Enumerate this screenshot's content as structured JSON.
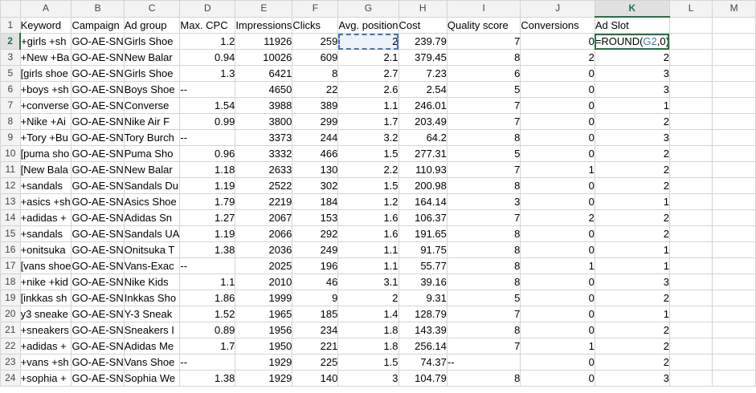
{
  "columns": [
    "A",
    "B",
    "C",
    "D",
    "E",
    "F",
    "G",
    "H",
    "I",
    "J",
    "K",
    "L",
    "M"
  ],
  "numeric_columns": [
    3,
    4,
    5,
    6,
    7,
    8,
    9,
    10
  ],
  "selected_column": "K",
  "selected_row": "2",
  "formula_cell": {
    "column_index": 10,
    "prefix": "=ROUND(",
    "reference": "G2",
    "suffix": ",0)"
  },
  "referenced_cell": {
    "row": "2",
    "column_index": 6
  },
  "rows": [
    {
      "n": "1",
      "cells": [
        "Keyword",
        "Campaign",
        "Ad group",
        "Max. CPC",
        "Impressions",
        "Clicks",
        "Avg. position",
        "Cost",
        "Quality score",
        "Conversions",
        "Ad Slot",
        "",
        ""
      ]
    },
    {
      "n": "2",
      "cells": [
        "+girls +sh",
        "GO-AE-SN",
        "Girls Shoe",
        "1.2",
        "11926",
        "259",
        "2",
        "239.79",
        "7",
        "0",
        "",
        "",
        ""
      ]
    },
    {
      "n": "3",
      "cells": [
        "+New +Ba",
        "GO-AE-SN",
        "New Balar",
        "0.94",
        "10026",
        "609",
        "2.1",
        "379.45",
        "8",
        "2",
        "2",
        "",
        ""
      ]
    },
    {
      "n": "5",
      "cells": [
        "[girls shoe",
        "GO-AE-SN",
        "Girls Shoe",
        "1.3",
        "6421",
        "8",
        "2.7",
        "7.23",
        "6",
        "0",
        "3",
        "",
        ""
      ]
    },
    {
      "n": "6",
      "cells": [
        "+boys +sh",
        "GO-AE-SN",
        "Boys Shoe",
        "--",
        "4650",
        "22",
        "2.6",
        "2.54",
        "5",
        "0",
        "3",
        "",
        ""
      ]
    },
    {
      "n": "7",
      "cells": [
        "+converse",
        "GO-AE-SN",
        "Converse",
        "1.54",
        "3988",
        "389",
        "1.1",
        "246.01",
        "7",
        "0",
        "1",
        "",
        ""
      ]
    },
    {
      "n": "8",
      "cells": [
        "+Nike +Ai",
        "GO-AE-SN",
        "Nike  Air F",
        "0.99",
        "3800",
        "299",
        "1.7",
        "203.49",
        "7",
        "0",
        "2",
        "",
        ""
      ]
    },
    {
      "n": "9",
      "cells": [
        "+Tory +Bu",
        "GO-AE-SN",
        "Tory Burch",
        "--",
        "3373",
        "244",
        "3.2",
        "64.2",
        "8",
        "0",
        "3",
        "",
        ""
      ]
    },
    {
      "n": "10",
      "cells": [
        "[puma sho",
        "GO-AE-SN",
        "Puma Sho",
        "0.96",
        "3332",
        "466",
        "1.5",
        "277.31",
        "5",
        "0",
        "2",
        "",
        ""
      ]
    },
    {
      "n": "11",
      "cells": [
        "[New Bala",
        "GO-AE-SN",
        "New Balar",
        "1.18",
        "2633",
        "130",
        "2.2",
        "110.93",
        "7",
        "1",
        "2",
        "",
        ""
      ]
    },
    {
      "n": "12",
      "cells": [
        "+sandals",
        "GO-AE-SN",
        "Sandals Du",
        "1.19",
        "2522",
        "302",
        "1.5",
        "200.98",
        "8",
        "0",
        "2",
        "",
        ""
      ]
    },
    {
      "n": "13",
      "cells": [
        "+asics +sh",
        "GO-AE-SN",
        "Asics Shoe",
        "1.79",
        "2219",
        "184",
        "1.2",
        "164.14",
        "3",
        "0",
        "1",
        "",
        ""
      ]
    },
    {
      "n": "14",
      "cells": [
        "+adidas +",
        "GO-AE-SN",
        "Adidas Sn",
        "1.27",
        "2067",
        "153",
        "1.6",
        "106.37",
        "7",
        "2",
        "2",
        "",
        ""
      ]
    },
    {
      "n": "15",
      "cells": [
        "+sandals",
        "GO-AE-SN",
        "Sandals UA",
        "1.19",
        "2066",
        "292",
        "1.6",
        "191.65",
        "8",
        "0",
        "2",
        "",
        ""
      ]
    },
    {
      "n": "16",
      "cells": [
        "+onitsuka",
        "GO-AE-SN",
        "Onitsuka T",
        "1.38",
        "2036",
        "249",
        "1.1",
        "91.75",
        "8",
        "0",
        "1",
        "",
        ""
      ]
    },
    {
      "n": "17",
      "cells": [
        "[vans shoe",
        "GO-AE-SN",
        "Vans-Exac",
        "--",
        "2025",
        "196",
        "1.1",
        "55.77",
        "8",
        "1",
        "1",
        "",
        ""
      ]
    },
    {
      "n": "18",
      "cells": [
        "+nike +kid",
        "GO-AE-SN",
        "Nike Kids",
        "1.1",
        "2010",
        "46",
        "3.1",
        "39.16",
        "8",
        "0",
        "3",
        "",
        ""
      ]
    },
    {
      "n": "19",
      "cells": [
        "[inkkas sh",
        "GO-AE-SN",
        "Inkkas Sho",
        "1.86",
        "1999",
        "9",
        "2",
        "9.31",
        "5",
        "0",
        "2",
        "",
        ""
      ]
    },
    {
      "n": "20",
      "cells": [
        "y3 sneake",
        "GO-AE-SN",
        "Y-3 Sneak",
        "1.52",
        "1965",
        "185",
        "1.4",
        "128.79",
        "7",
        "0",
        "1",
        "",
        ""
      ]
    },
    {
      "n": "21",
      "cells": [
        "+sneakers",
        "GO-AE-SN",
        "Sneakers I",
        "0.89",
        "1956",
        "234",
        "1.8",
        "143.39",
        "8",
        "0",
        "2",
        "",
        ""
      ]
    },
    {
      "n": "22",
      "cells": [
        "+adidas +",
        "GO-AE-SN",
        "Adidas Me",
        "1.7",
        "1950",
        "221",
        "1.8",
        "256.14",
        "7",
        "1",
        "2",
        "",
        ""
      ]
    },
    {
      "n": "23",
      "cells": [
        "+vans +sh",
        "GO-AE-SN",
        "Vans Shoe",
        "--",
        "1929",
        "225",
        "1.5",
        "74.37",
        "--",
        "0",
        "2",
        "",
        ""
      ]
    },
    {
      "n": "24",
      "cells": [
        "+sophia +",
        "GO-AE-SN",
        "Sophia We",
        "1.38",
        "1929",
        "140",
        "3",
        "104.79",
        "8",
        "0",
        "3",
        "",
        ""
      ]
    }
  ]
}
